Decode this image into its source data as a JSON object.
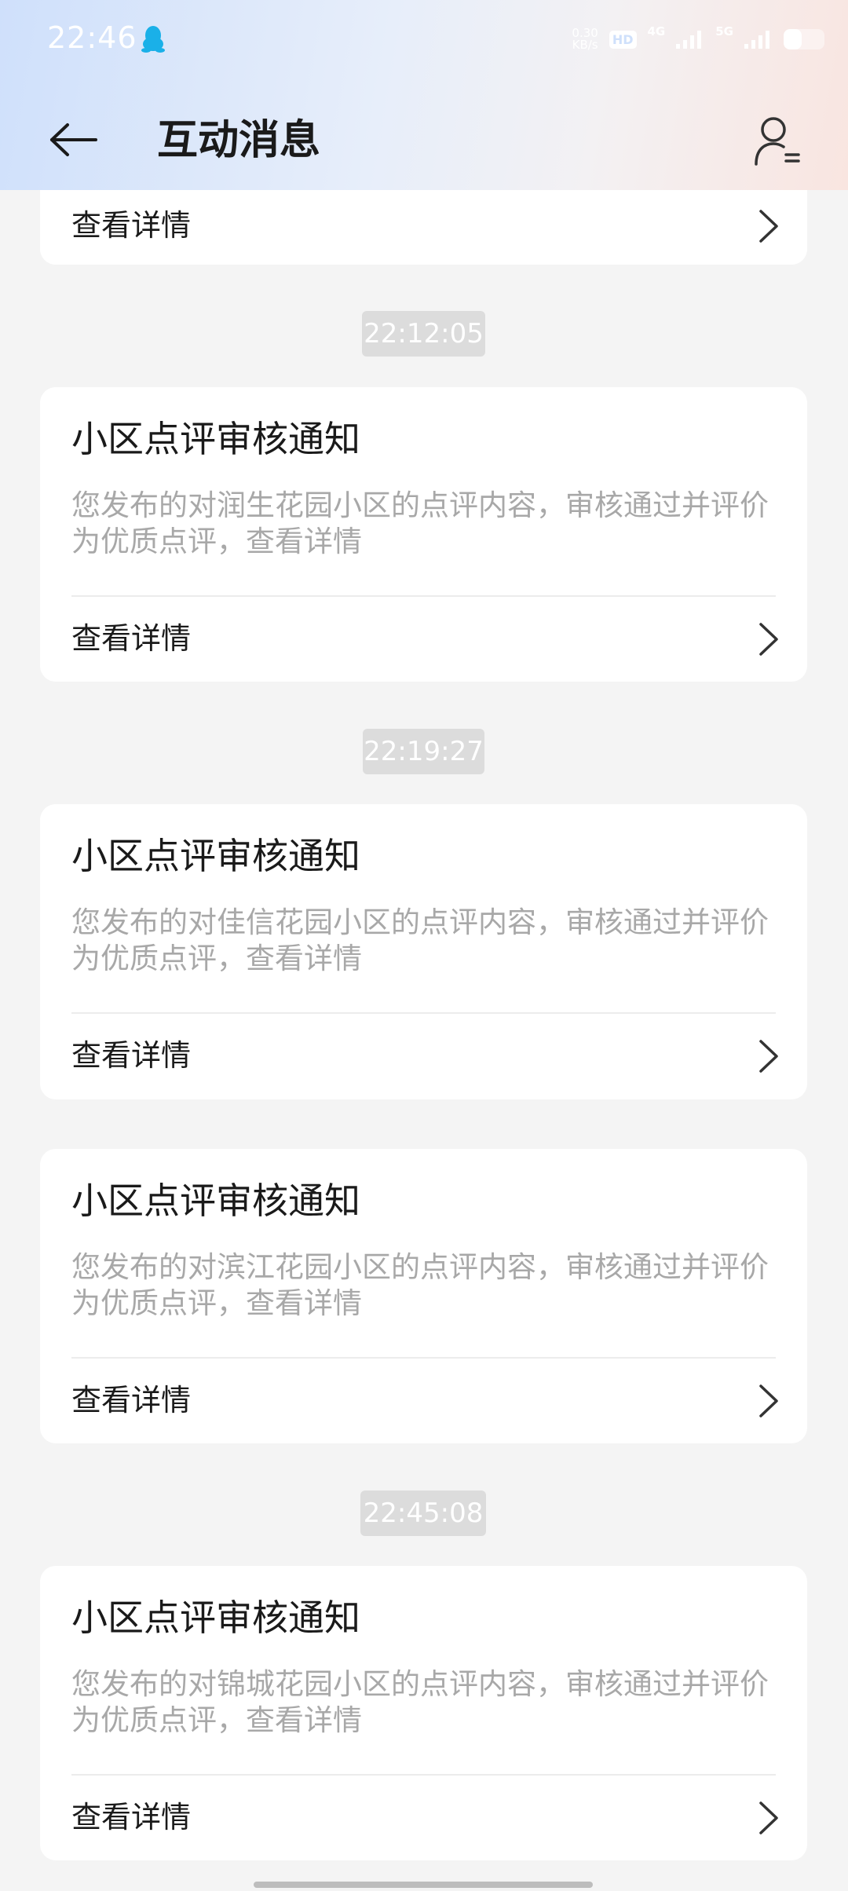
{
  "status_bar": {
    "time": "22:46",
    "net_speed_value": "0.30",
    "net_speed_unit": "KB/s",
    "hd_label": "HD",
    "net1": "4G",
    "net2": "5G",
    "battery_level": 0.45,
    "qq_icon": "qq-penguin-icon"
  },
  "header": {
    "title": "互动消息",
    "back_icon": "arrow-left-icon",
    "profile_icon": "user-settings-icon"
  },
  "partial_card": {
    "link_label": "查看详情"
  },
  "timestamps": [
    "22:12:05",
    "22:19:27",
    "22:45:08"
  ],
  "messages": [
    {
      "title": "小区点评审核通知",
      "body": "您发布的对润生花园小区的点评内容，审核通过并评价为优质点评，查看详情",
      "link_label": "查看详情"
    },
    {
      "title": "小区点评审核通知",
      "body": "您发布的对佳信花园小区的点评内容，审核通过并评价为优质点评，查看详情",
      "link_label": "查看详情"
    },
    {
      "title": "小区点评审核通知",
      "body": "您发布的对滨江花园小区的点评内容，审核通过并评价为优质点评，查看详情",
      "link_label": "查看详情"
    },
    {
      "title": "小区点评审核通知",
      "body": "您发布的对锦城花园小区的点评内容，审核通过并评价为优质点评，查看详情",
      "link_label": "查看详情"
    }
  ],
  "colors": {
    "background": "#f4f4f4",
    "card": "#ffffff",
    "body_text": "#a8a8a8",
    "timestamp_badge": "#dcdcdc"
  }
}
